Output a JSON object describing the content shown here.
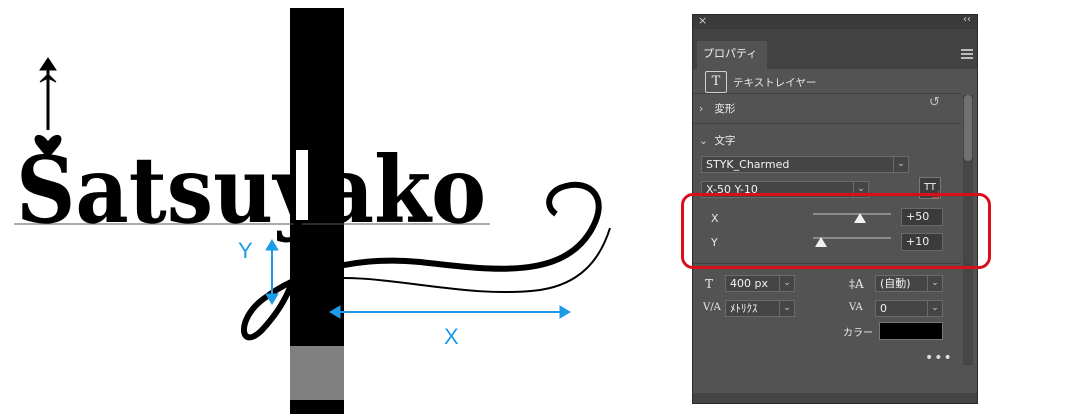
{
  "artwork": {
    "logo_text": "Satsuyako",
    "y_label": "Y",
    "x_label": "X",
    "dimension_color": "#1e9be6"
  },
  "panel": {
    "title_tab": "プロパティ",
    "layer_type": "テキストレイヤー",
    "section_transform": "変形",
    "section_text": "文字",
    "font_family": "STYK_Charmed",
    "font_style": "X-50 Y-10",
    "tt_icon": "TT",
    "x_label": "X",
    "x_value": "+50",
    "x_level": 0.6,
    "y_label": "Y",
    "y_value": "+10",
    "y_level": 0.1,
    "font_size": "400 px",
    "leading": "(自動)",
    "kerning": "ﾒﾄﾘｸｽ",
    "tracking": "0",
    "color_label": "カラー",
    "color_value": "#000000",
    "more": "•••"
  },
  "highlight_color": "#d8101c"
}
